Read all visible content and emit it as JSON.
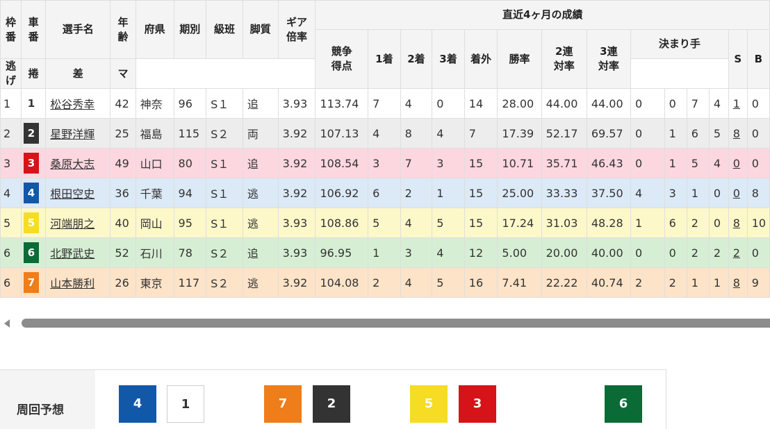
{
  "header": {
    "waku": [
      "枠",
      "番"
    ],
    "sha": [
      "車",
      "番"
    ],
    "name": "選手名",
    "age": [
      "年",
      "齢"
    ],
    "pref": "府県",
    "term": "期別",
    "rank": "級班",
    "style": "脚質",
    "gear": [
      "ギア",
      "倍率"
    ],
    "recent": "直近4ヶ月の成績",
    "score": [
      "競争",
      "得点"
    ],
    "first": "1着",
    "second": "2着",
    "third": "3着",
    "out": "着外",
    "winrate": "勝率",
    "rate2": [
      "2連",
      "対率"
    ],
    "rate3": [
      "3連",
      "対率"
    ],
    "kimarite": "決まり手",
    "nige": "逃げ",
    "makuri": "捲",
    "sashi": "差",
    "mark": "マ",
    "s": "S",
    "b": "B"
  },
  "colors": {
    "1": {
      "bg": "#ffffff",
      "fg": "#333333",
      "row": "#ffffff"
    },
    "2": {
      "bg": "#333333",
      "fg": "#ffffff",
      "row": "#ededed"
    },
    "3": {
      "bg": "#d7131a",
      "fg": "#ffffff",
      "row": "#fcd7e0"
    },
    "4": {
      "bg": "#1158a8",
      "fg": "#ffffff",
      "row": "#dce9f6"
    },
    "5": {
      "bg": "#f6dc23",
      "fg": "#ffffff",
      "row": "#fdf8c9"
    },
    "6": {
      "bg": "#0a6b36",
      "fg": "#ffffff",
      "row": "#d6efd4"
    },
    "7": {
      "bg": "#ef7d1a",
      "fg": "#ffffff",
      "row": "#fde3c8"
    }
  },
  "rows": [
    {
      "waku": "1",
      "car": "1",
      "name": "松谷秀幸",
      "age": "42",
      "pref": "神奈",
      "term": "96",
      "rank": "S１",
      "style": "追",
      "gear": "3.93",
      "score": "113.74",
      "first": "7",
      "second": "4",
      "third": "0",
      "out": "14",
      "winrate": "28.00",
      "rate2": "44.00",
      "rate3": "44.00",
      "nige": "0",
      "makuri": "0",
      "sashi": "7",
      "mark": "4",
      "s": "1",
      "b": "0"
    },
    {
      "waku": "2",
      "car": "2",
      "name": "星野洋輝",
      "age": "25",
      "pref": "福島",
      "term": "115",
      "rank": "S２",
      "style": "両",
      "gear": "3.92",
      "score": "107.13",
      "first": "4",
      "second": "8",
      "third": "4",
      "out": "7",
      "winrate": "17.39",
      "rate2": "52.17",
      "rate3": "69.57",
      "nige": "0",
      "makuri": "1",
      "sashi": "6",
      "mark": "5",
      "s": "8",
      "b": "0"
    },
    {
      "waku": "3",
      "car": "3",
      "name": "桑原大志",
      "age": "49",
      "pref": "山口",
      "term": "80",
      "rank": "S１",
      "style": "追",
      "gear": "3.92",
      "score": "108.54",
      "first": "3",
      "second": "7",
      "third": "3",
      "out": "15",
      "winrate": "10.71",
      "rate2": "35.71",
      "rate3": "46.43",
      "nige": "0",
      "makuri": "1",
      "sashi": "5",
      "mark": "4",
      "s": "0",
      "b": "0"
    },
    {
      "waku": "4",
      "car": "4",
      "name": "根田空史",
      "age": "36",
      "pref": "千葉",
      "term": "94",
      "rank": "S１",
      "style": "逃",
      "gear": "3.92",
      "score": "106.92",
      "first": "6",
      "second": "2",
      "third": "1",
      "out": "15",
      "winrate": "25.00",
      "rate2": "33.33",
      "rate3": "37.50",
      "nige": "4",
      "makuri": "3",
      "sashi": "1",
      "mark": "0",
      "s": "0",
      "b": "8"
    },
    {
      "waku": "5",
      "car": "5",
      "name": "河端朋之",
      "age": "40",
      "pref": "岡山",
      "term": "95",
      "rank": "S１",
      "style": "逃",
      "gear": "3.93",
      "score": "108.86",
      "first": "5",
      "second": "4",
      "third": "5",
      "out": "15",
      "winrate": "17.24",
      "rate2": "31.03",
      "rate3": "48.28",
      "nige": "1",
      "makuri": "6",
      "sashi": "2",
      "mark": "0",
      "s": "8",
      "b": "10"
    },
    {
      "waku": "6",
      "car": "6",
      "name": "北野武史",
      "age": "52",
      "pref": "石川",
      "term": "78",
      "rank": "S２",
      "style": "追",
      "gear": "3.93",
      "score": "96.95",
      "first": "1",
      "second": "3",
      "third": "4",
      "out": "12",
      "winrate": "5.00",
      "rate2": "20.00",
      "rate3": "40.00",
      "nige": "0",
      "makuri": "0",
      "sashi": "2",
      "mark": "2",
      "s": "2",
      "b": "0"
    },
    {
      "waku": "6",
      "car": "7",
      "name": "山本勝利",
      "age": "26",
      "pref": "東京",
      "term": "117",
      "rank": "S２",
      "style": "逃",
      "gear": "3.92",
      "score": "104.08",
      "first": "2",
      "second": "4",
      "third": "5",
      "out": "16",
      "winrate": "7.41",
      "rate2": "22.22",
      "rate3": "40.74",
      "nige": "2",
      "makuri": "2",
      "sashi": "1",
      "mark": "1",
      "s": "8",
      "b": "9"
    }
  ],
  "prediction": {
    "label": "周回予想",
    "boxes": [
      "4",
      "1",
      "7",
      "2",
      "5",
      "3",
      "6"
    ]
  }
}
